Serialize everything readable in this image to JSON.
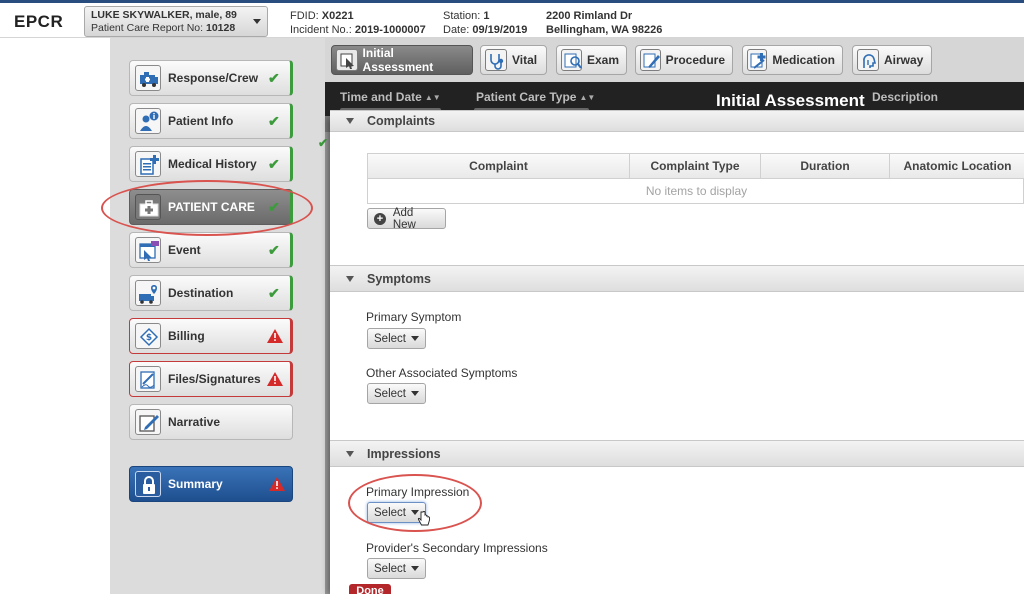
{
  "app": {
    "title": "EPCR"
  },
  "patient": {
    "name": "LUKE SKYWALKER, male, 89",
    "report_label": "Patient Care Report No:",
    "report_no": "10128"
  },
  "incident": {
    "fdid_label": "FDID:",
    "fdid": "X0221",
    "incident_label": "Incident No.:",
    "incident_no": "2019-1000007",
    "station_label": "Station:",
    "station": "1",
    "date_label": "Date:",
    "date": "09/19/2019",
    "address_line1": "2200 Rimland Dr",
    "address_line2": "Bellingham, WA 98226"
  },
  "sidebar": {
    "items": [
      {
        "label": "Response/Crew",
        "status": "ok",
        "icon": "ambulance-icon"
      },
      {
        "label": "Patient Info",
        "status": "ok",
        "icon": "patient-info-icon"
      },
      {
        "label": "Medical History",
        "status": "ok",
        "icon": "medical-history-icon"
      },
      {
        "label": "PATIENT CARE",
        "status": "ok",
        "icon": "medical-kit-icon"
      },
      {
        "label": "Event",
        "status": "ok",
        "icon": "event-icon"
      },
      {
        "label": "Destination",
        "status": "ok",
        "icon": "destination-icon"
      },
      {
        "label": "Billing",
        "status": "warn",
        "icon": "billing-icon"
      },
      {
        "label": "Files/Signatures",
        "status": "warn",
        "icon": "signature-icon"
      },
      {
        "label": "Narrative",
        "status": "none",
        "icon": "narrative-icon"
      }
    ],
    "summary": {
      "label": "Summary",
      "status": "warn",
      "icon": "lock-icon"
    }
  },
  "tabs": [
    {
      "label": "Initial Assessment",
      "icon": "assessment-icon",
      "active": true
    },
    {
      "label": "Vital",
      "icon": "stethoscope-icon"
    },
    {
      "label": "Exam",
      "icon": "exam-icon"
    },
    {
      "label": "Procedure",
      "icon": "procedure-icon"
    },
    {
      "label": "Medication",
      "icon": "medication-icon"
    },
    {
      "label": "Airway",
      "icon": "airway-icon"
    }
  ],
  "list_header": {
    "columns": [
      "Time and Date",
      "Patient Care Type",
      "Description"
    ],
    "title": "Initial Assessment"
  },
  "complaints": {
    "section_title": "Complaints",
    "columns": [
      "Complaint",
      "Complaint Type",
      "Duration",
      "Anatomic Location"
    ],
    "empty_text": "No items to display",
    "add_label": "Add New"
  },
  "symptoms": {
    "section_title": "Symptoms",
    "primary_label": "Primary Symptom",
    "primary_value": "Select",
    "other_label": "Other Associated Symptoms",
    "other_value": "Select"
  },
  "impressions": {
    "section_title": "Impressions",
    "primary_label": "Primary Impression",
    "primary_value": "Select",
    "secondary_label": "Provider's Secondary Impressions",
    "secondary_value": "Select"
  },
  "footer": {
    "done_label": "Done"
  },
  "colors": {
    "brand": "#2a4d7f",
    "ok": "#3c9b3c",
    "warn": "#c43a3a",
    "annotation": "#d9534f",
    "summary": "#2a5da0"
  }
}
